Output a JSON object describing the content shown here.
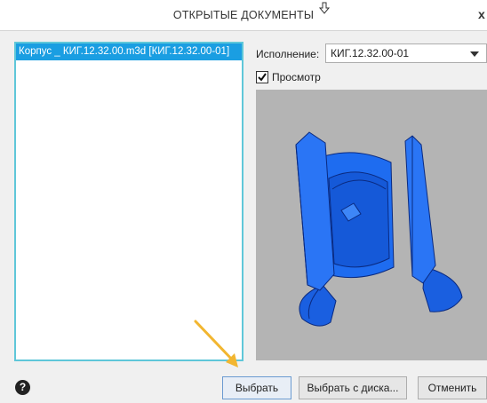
{
  "window": {
    "title": "ОТКРЫТЫЕ ДОКУМЕНТЫ",
    "close_glyph": "x"
  },
  "documents": [
    {
      "label": "Корпус _ КИГ.12.32.00.m3d [КИГ.12.32.00-01]",
      "selected": true
    }
  ],
  "execution": {
    "label": "Исполнение:",
    "value": "КИГ.12.32.00-01"
  },
  "preview": {
    "label": "Просмотр",
    "checked": true
  },
  "buttons": {
    "select": "Выбрать",
    "select_from_disk": "Выбрать с диска...",
    "cancel": "Отменить"
  },
  "colors": {
    "selection": "#1a9ee2",
    "list_border": "#5fc7d9",
    "model_blue": "#1060e8",
    "viewport_bg": "#b4b4b4",
    "annotation_arrow": "#f2b630"
  }
}
